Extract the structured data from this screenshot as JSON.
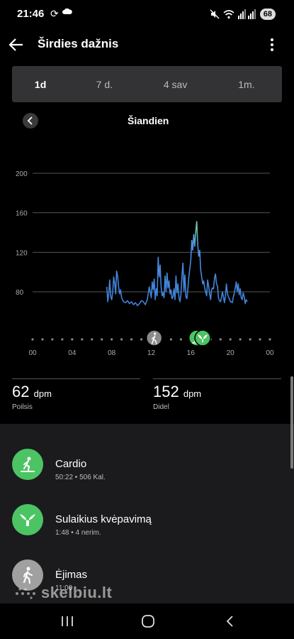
{
  "status_bar": {
    "time": "21:46",
    "battery": "68",
    "sync_icon": "sync-icon",
    "cloud_icon": "cloud-icon",
    "mute_icon": "mute-icon",
    "wifi_icon": "wifi-icon",
    "signal_icon": "signal-icon"
  },
  "app_bar": {
    "title": "Širdies dažnis",
    "back_icon": "arrow-left-icon",
    "menu_icon": "more-vertical-icon"
  },
  "tabs": [
    {
      "label": "1d",
      "active": true
    },
    {
      "label": "7 d.",
      "active": false
    },
    {
      "label": "4 sav",
      "active": false
    },
    {
      "label": "1m.",
      "active": false
    }
  ],
  "day_nav": {
    "label": "Šiandien"
  },
  "chart_data": {
    "type": "line",
    "title": "",
    "xlabel": "",
    "ylabel": "",
    "x_ticks": [
      "00",
      "04",
      "08",
      "12",
      "16",
      "20",
      "00"
    ],
    "y_ticks": [
      80,
      120,
      160,
      200
    ],
    "xlim": [
      0,
      24
    ],
    "ylim": [
      50,
      210
    ],
    "grid": true,
    "line_color": "#4a8fe0",
    "peak_color": "#74d39a",
    "series": [
      {
        "x": [
          7.5,
          7.6,
          7.7,
          7.8,
          7.9,
          8.0,
          8.1,
          8.2,
          8.3,
          8.4,
          8.5,
          8.6,
          8.7,
          8.8,
          8.9,
          9.0,
          9.2,
          9.4,
          9.6,
          9.8,
          10.0,
          10.2,
          10.4,
          10.6,
          10.8,
          11.0,
          11.2,
          11.4,
          11.6,
          11.8,
          12.0,
          12.1,
          12.2,
          12.3,
          12.4,
          12.5,
          12.6,
          12.7,
          12.8,
          12.9,
          13.0,
          13.1,
          13.2,
          13.3,
          13.4,
          13.5,
          13.6,
          13.7,
          13.8,
          13.9,
          14.0,
          14.1,
          14.2,
          14.3,
          14.4,
          14.5,
          14.6,
          14.7,
          14.8,
          14.9,
          15.0,
          15.1,
          15.2,
          15.3,
          15.4,
          15.5,
          15.6,
          15.7,
          15.8,
          15.9,
          16.0,
          16.1,
          16.2,
          16.3,
          16.4,
          16.5,
          16.6,
          16.7,
          16.8,
          16.9,
          17.0,
          17.1,
          17.2,
          17.3,
          17.4,
          17.5,
          17.6,
          17.7,
          17.8,
          17.9,
          18.0,
          18.1,
          18.2,
          18.3,
          18.4,
          18.5,
          18.6,
          18.7,
          18.8,
          18.9,
          19.0,
          19.1,
          19.2,
          19.3,
          19.4,
          19.5,
          19.6,
          19.7,
          19.8,
          19.9,
          20.0,
          20.1,
          20.2,
          20.3,
          20.4,
          20.5,
          20.6,
          20.7,
          20.8,
          20.9,
          21.0,
          21.1,
          21.2,
          21.3,
          21.4,
          21.5,
          21.6,
          21.7
        ],
        "y": [
          85,
          70,
          78,
          92,
          75,
          72,
          80,
          95,
          88,
          78,
          101,
          96,
          85,
          78,
          82,
          74,
          70,
          69,
          71,
          68,
          70,
          67,
          69,
          66,
          68,
          71,
          70,
          67,
          72,
          85,
          74,
          90,
          82,
          93,
          72,
          83,
          76,
          115,
          95,
          107,
          84,
          76,
          79,
          74,
          96,
          80,
          99,
          84,
          91,
          78,
          82,
          73,
          75,
          83,
          72,
          96,
          79,
          88,
          74,
          70,
          77,
          96,
          109,
          81,
          97,
          75,
          73,
          82,
          95,
          103,
          112,
          132,
          122,
          138,
          126,
          141,
          151,
          128,
          116,
          122,
          102,
          95,
          88,
          91,
          84,
          80,
          76,
          92,
          86,
          78,
          72,
          82,
          84,
          83,
          94,
          98,
          88,
          86,
          74,
          71,
          70,
          74,
          80,
          75,
          69,
          76,
          88,
          78,
          75,
          73,
          70,
          70,
          69,
          75,
          79,
          84,
          90,
          80,
          88,
          77,
          83,
          74,
          72,
          79,
          75,
          68,
          72,
          70
        ]
      }
    ],
    "activity_markers": [
      {
        "x": 12.3,
        "type": "walking",
        "color": "#8a8a8a"
      },
      {
        "x": 16.6,
        "type": "cardio",
        "color": "#4cc463"
      },
      {
        "x": 17.2,
        "type": "breath-hold",
        "color": "#4cc463"
      }
    ]
  },
  "stats": {
    "rest": {
      "value": "62",
      "unit": "dpm",
      "label": "Poilsis"
    },
    "max": {
      "value": "152",
      "unit": "dpm",
      "label": "Didel"
    }
  },
  "activities": [
    {
      "name": "Cardio",
      "sub": "50:22 • 506 Kal.",
      "icon": "treadmill-icon",
      "color": "#4cc463"
    },
    {
      "name": "Sulaikius kvėpavimą",
      "sub": "1:48 • 4 nerim.",
      "icon": "whale-tail-icon",
      "color": "#4cc463"
    },
    {
      "name": "Ėjimas",
      "sub": "11:00",
      "icon": "walking-icon",
      "color": "#a0a0a0"
    }
  ],
  "watermark": "skelbiu.lt",
  "nav_bar": {
    "recents_icon": "recents-icon",
    "home_icon": "home-icon",
    "back_icon": "back-chevron-icon"
  }
}
